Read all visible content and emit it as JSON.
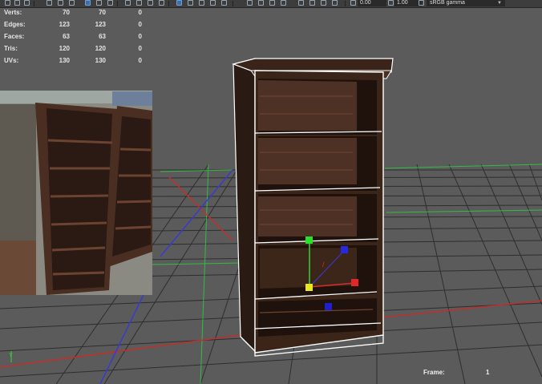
{
  "toolbar": {
    "field_1": "0.00",
    "field_2": "1.00",
    "color_space": "sRGB gamma"
  },
  "hud": {
    "rows": [
      {
        "label": "Verts:",
        "v1": "70",
        "v2": "70",
        "v3": "0"
      },
      {
        "label": "Edges:",
        "v1": "123",
        "v2": "123",
        "v3": "0"
      },
      {
        "label": "Faces:",
        "v1": "63",
        "v2": "63",
        "v3": "0"
      },
      {
        "label": "Tris:",
        "v1": "120",
        "v2": "120",
        "v3": "0"
      },
      {
        "label": "UVs:",
        "v1": "130",
        "v2": "130",
        "v3": "0"
      }
    ]
  },
  "frame": {
    "label": "Frame:",
    "value": "1"
  },
  "axis": {
    "y_label": "Y"
  },
  "colors": {
    "viewport_bg": "#5b5b5b",
    "grid": "#2b2b2b",
    "x_axis": "#c0302a",
    "z_axis": "#3a3ad0",
    "green_lines": "#2ecc40",
    "wood": "#4a2f22"
  }
}
